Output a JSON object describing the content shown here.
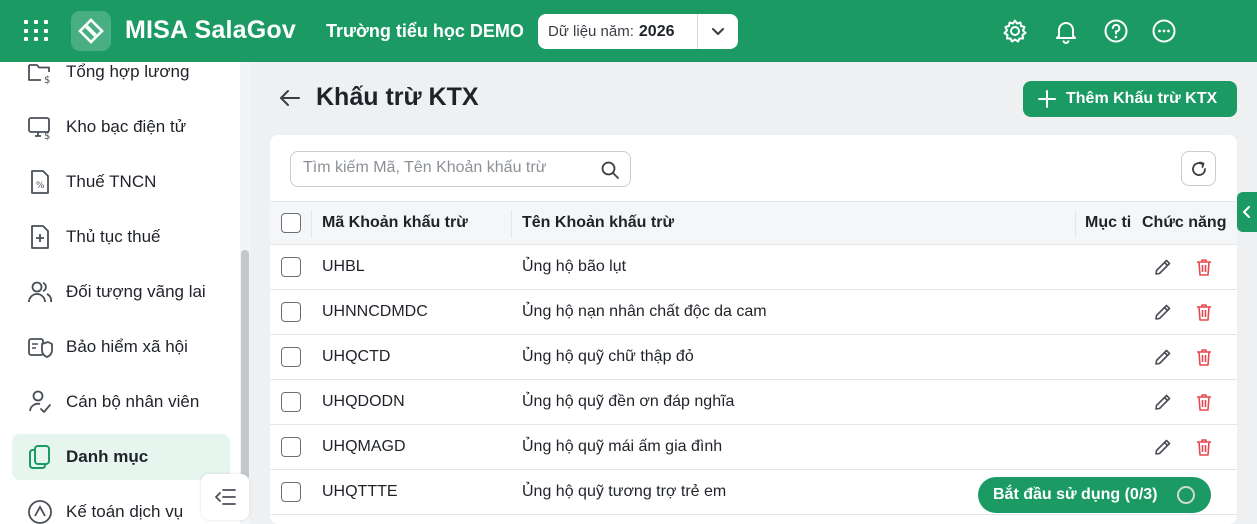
{
  "header": {
    "app_name": "MISA SalaGov",
    "school": "Trường tiểu học DEMO",
    "year_label": "Dữ liệu năm:",
    "year_value": "2026",
    "brand_color": "#1b9b63"
  },
  "sidebar": {
    "items": [
      {
        "label": "Tổng hợp lương",
        "icon": "folder-money-icon"
      },
      {
        "label": "Kho bạc điện tử",
        "icon": "monitor-money-icon"
      },
      {
        "label": "Thuế TNCN",
        "icon": "tax-document-icon"
      },
      {
        "label": "Thủ tục thuế",
        "icon": "document-plus-icon"
      },
      {
        "label": "Đối tượng vãng lai",
        "icon": "users-icon"
      },
      {
        "label": "Bảo hiểm xã hội",
        "icon": "insurance-shield-icon"
      },
      {
        "label": "Cán bộ nhân viên",
        "icon": "user-check-icon"
      },
      {
        "label": "Danh mục",
        "icon": "catalog-icon",
        "active": true
      },
      {
        "label": "Kế toán dịch vụ",
        "icon": "accounting-icon"
      }
    ]
  },
  "page": {
    "title": "Khấu trừ KTX",
    "add_button": "Thêm Khấu trừ KTX"
  },
  "search": {
    "placeholder": "Tìm kiếm Mã, Tên Khoản khấu trừ"
  },
  "table": {
    "columns": [
      "Mã Khoản khấu trừ",
      "Tên Khoản khấu trừ",
      "Mục ti",
      "Chức năng"
    ],
    "rows": [
      {
        "code": "UHBL",
        "name": "Ủng hộ bão lụt"
      },
      {
        "code": "UHNNCDMDC",
        "name": "Ủng hộ nạn nhân chất độc da cam"
      },
      {
        "code": "UHQCTD",
        "name": "Ủng hộ quỹ chữ thập đỏ"
      },
      {
        "code": "UHQDODN",
        "name": "Ủng hộ quỹ đền ơn đáp nghĩa"
      },
      {
        "code": "UHQMAGD",
        "name": "Ủng hộ quỹ mái ấm gia đình"
      },
      {
        "code": "UHQTTTE",
        "name": "Ủng hộ quỹ tương trợ trẻ em"
      }
    ]
  },
  "onboarding": {
    "label": "Bắt đầu sử dụng (0/3)"
  }
}
